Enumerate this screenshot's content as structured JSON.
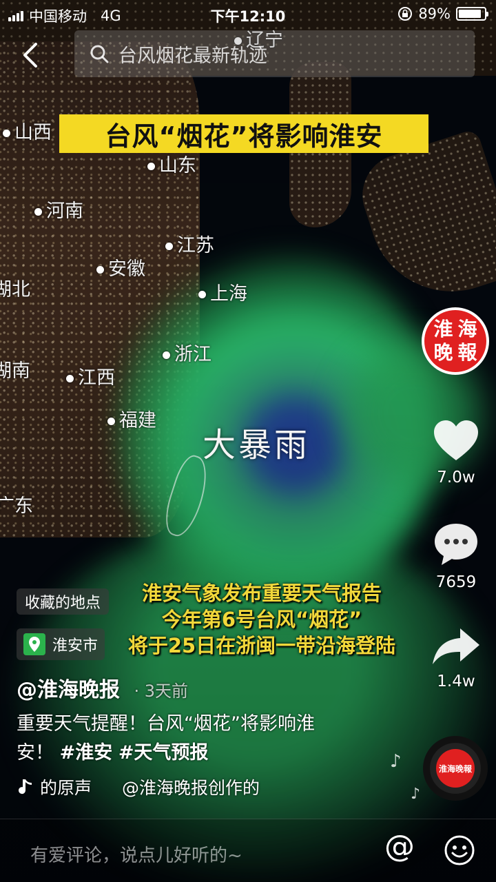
{
  "status_bar": {
    "carrier": "中国移动",
    "network": "4G",
    "time": "下午12:10",
    "battery": "89%",
    "battery_level": 0.89
  },
  "search": {
    "query": "台风烟花最新轨迹"
  },
  "map_labels": [
    "辽宁",
    "山西",
    "山东",
    "河南",
    "江苏",
    "安徽",
    "湖北",
    "上海",
    "浙江",
    "湖南",
    "江西",
    "福建",
    "广东"
  ],
  "video": {
    "headline": "台风“烟花”将影响淮安",
    "storm_label": "大暴雨",
    "caption_lines": [
      "淮安气象发布重要天气报告",
      "今年第6号台风“烟花”",
      "将于25日在浙闽一带沿海登陆"
    ]
  },
  "avatar": {
    "chars": [
      "淮",
      "海",
      "晚",
      "報"
    ]
  },
  "actions": {
    "likes": "7.0w",
    "comments": "7659",
    "shares": "1.4w"
  },
  "poi": {
    "collect": "收藏的地点",
    "location": "淮安市"
  },
  "post": {
    "author": "@淮海晚报",
    "time": "· 3天前",
    "text": "重要天气提醒！台风“烟花”将影响淮安！",
    "tags": [
      "#淮安",
      "#天气预报"
    ]
  },
  "music": {
    "left": "的原声",
    "right": "@淮海晚报创作的"
  },
  "disc_label": "淮海晚報",
  "comment_bar": {
    "placeholder": "有爱评论，说点儿好听的~"
  }
}
